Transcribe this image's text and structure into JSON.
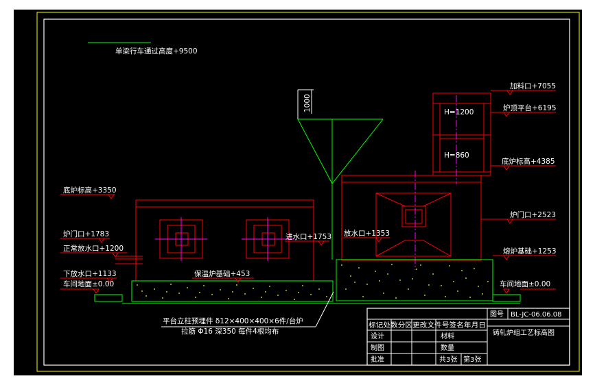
{
  "drawing": {
    "overhead_crane_clearance": "单梁行车通过高度+9500",
    "left_furnace": {
      "base_level": "底炉标高+3350",
      "door": "炉门口+1783",
      "normal_drain": "正常放水口+1200",
      "lower_drain": "下放水口+1133",
      "floor": "车间地面±0.00",
      "insulation_base": "保温炉基础+453",
      "water_inlet": "进水口+1753",
      "water_outlet": "放水口+1353"
    },
    "right_furnace": {
      "charging_port": "加料口+7055",
      "top_platform": "炉顶平台+6195",
      "base_level": "底炉标高+4385",
      "door": "炉门口+2523",
      "melting_base": "熔炉基础+1253",
      "floor": "车间地面±0.00",
      "h1": "H=1200",
      "h2": "H=860"
    },
    "dim_1000": "1000",
    "note_line1": "平台立柱预埋件 δ12×400×400×6件/台炉",
    "note_line2": "拉筋 Φ16 深350 每件4根均布"
  },
  "title_block": {
    "drawing_no_label": "图号",
    "drawing_no": "BL-JC-06.06.08",
    "drawing_title": "铸轧炉组工艺标高图",
    "revision_header": "标记处数分区更改文件号签名年月日",
    "design": "设计",
    "drafting": "制图",
    "approval": "批准",
    "material": "材料",
    "quantity": "数量",
    "sheets_total": "共3张",
    "sheet_no": "第3张"
  },
  "colors": {
    "background": "#000000",
    "frame": "#ffffff",
    "outer_frame": "#ffff00",
    "structure": "#ff0000",
    "lines": "#00ff00",
    "center": "#ff00ff",
    "text": "#ffffff"
  }
}
